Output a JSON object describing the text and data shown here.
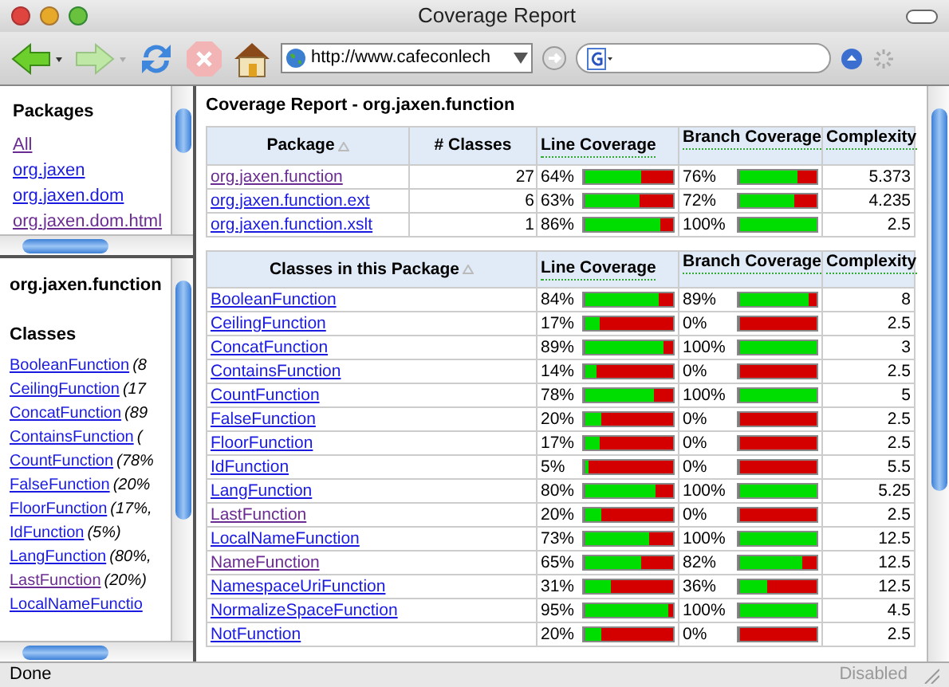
{
  "window": {
    "title": "Coverage Report"
  },
  "toolbar": {
    "url": "http://www.cafeconlech"
  },
  "sidebar": {
    "packages": {
      "heading": "Packages",
      "items": [
        {
          "label": "All",
          "visited": true
        },
        {
          "label": "org.jaxen",
          "visited": false
        },
        {
          "label": "org.jaxen.dom",
          "visited": false
        },
        {
          "label": "org.jaxen.dom.html",
          "visited": true
        }
      ]
    },
    "classes": {
      "package_title": "org.jaxen.function",
      "heading": "Classes",
      "items": [
        {
          "label": "BooleanFunction",
          "note": "(8",
          "visited": false
        },
        {
          "label": "CeilingFunction",
          "note": "(17",
          "visited": false
        },
        {
          "label": "ConcatFunction",
          "note": "(89",
          "visited": false
        },
        {
          "label": "ContainsFunction",
          "note": "(",
          "visited": false
        },
        {
          "label": "CountFunction",
          "note": "(78%",
          "visited": false
        },
        {
          "label": "FalseFunction",
          "note": "(20%",
          "visited": false
        },
        {
          "label": "FloorFunction",
          "note": "(17%,",
          "visited": false
        },
        {
          "label": "IdFunction",
          "note": "(5%)",
          "visited": false
        },
        {
          "label": "LangFunction",
          "note": "(80%,",
          "visited": false
        },
        {
          "label": "LastFunction",
          "note": "(20%)",
          "visited": true
        },
        {
          "label": "LocalNameFunctio",
          "visited": false
        }
      ]
    }
  },
  "report": {
    "title": "Coverage Report - org.jaxen.function",
    "package_table": {
      "columns": [
        "Package",
        "# Classes",
        "Line Coverage",
        "Branch Coverage",
        "Complexity"
      ],
      "rows": [
        {
          "name": "org.jaxen.function",
          "visited": true,
          "classes": "27",
          "line": {
            "reading": "64%",
            "level": 0.64
          },
          "branch": {
            "reading": "76%",
            "level": 0.76
          },
          "complexity": "5.373"
        },
        {
          "name": "org.jaxen.function.ext",
          "visited": false,
          "classes": "6",
          "line": {
            "reading": "63%",
            "level": 0.63
          },
          "branch": {
            "reading": "72%",
            "level": 0.72
          },
          "complexity": "4.235"
        },
        {
          "name": "org.jaxen.function.xslt",
          "visited": false,
          "classes": "1",
          "line": {
            "reading": "86%",
            "level": 0.86
          },
          "branch": {
            "reading": "100%",
            "level": 1
          },
          "complexity": "2.5"
        }
      ]
    },
    "class_table": {
      "columns": [
        "Classes in this Package",
        "Line Coverage",
        "Branch Coverage",
        "Complexity"
      ],
      "rows": [
        {
          "name": "BooleanFunction",
          "visited": false,
          "line": {
            "reading": "84%",
            "level": 0.84
          },
          "branch": {
            "reading": "89%",
            "level": 0.89
          },
          "complexity": "8"
        },
        {
          "name": "CeilingFunction",
          "visited": false,
          "line": {
            "reading": "17%",
            "level": 0.17
          },
          "branch": {
            "reading": "0%",
            "level": 0
          },
          "complexity": "2.5"
        },
        {
          "name": "ConcatFunction",
          "visited": false,
          "line": {
            "reading": "89%",
            "level": 0.89
          },
          "branch": {
            "reading": "100%",
            "level": 1
          },
          "complexity": "3"
        },
        {
          "name": "ContainsFunction",
          "visited": false,
          "line": {
            "reading": "14%",
            "level": 0.14
          },
          "branch": {
            "reading": "0%",
            "level": 0
          },
          "complexity": "2.5"
        },
        {
          "name": "CountFunction",
          "visited": false,
          "line": {
            "reading": "78%",
            "level": 0.78
          },
          "branch": {
            "reading": "100%",
            "level": 1
          },
          "complexity": "5"
        },
        {
          "name": "FalseFunction",
          "visited": false,
          "line": {
            "reading": "20%",
            "level": 0.2
          },
          "branch": {
            "reading": "0%",
            "level": 0
          },
          "complexity": "2.5"
        },
        {
          "name": "FloorFunction",
          "visited": false,
          "line": {
            "reading": "17%",
            "level": 0.17
          },
          "branch": {
            "reading": "0%",
            "level": 0
          },
          "complexity": "2.5"
        },
        {
          "name": "IdFunction",
          "visited": false,
          "line": {
            "reading": "5%",
            "level": 0.05
          },
          "branch": {
            "reading": "0%",
            "level": 0
          },
          "complexity": "5.5"
        },
        {
          "name": "LangFunction",
          "visited": false,
          "line": {
            "reading": "80%",
            "level": 0.8
          },
          "branch": {
            "reading": "100%",
            "level": 1
          },
          "complexity": "5.25"
        },
        {
          "name": "LastFunction",
          "visited": true,
          "line": {
            "reading": "20%",
            "level": 0.2
          },
          "branch": {
            "reading": "0%",
            "level": 0
          },
          "complexity": "2.5"
        },
        {
          "name": "LocalNameFunction",
          "visited": false,
          "line": {
            "reading": "73%",
            "level": 0.73
          },
          "branch": {
            "reading": "100%",
            "level": 1
          },
          "complexity": "12.5"
        },
        {
          "name": "NameFunction",
          "visited": true,
          "line": {
            "reading": "65%",
            "level": 0.65
          },
          "branch": {
            "reading": "82%",
            "level": 0.82
          },
          "complexity": "12.5"
        },
        {
          "name": "NamespaceUriFunction",
          "visited": false,
          "line": {
            "reading": "31%",
            "level": 0.31
          },
          "branch": {
            "reading": "36%",
            "level": 0.36
          },
          "complexity": "12.5"
        },
        {
          "name": "NormalizeSpaceFunction",
          "visited": false,
          "line": {
            "reading": "95%",
            "level": 0.95
          },
          "branch": {
            "reading": "100%",
            "level": 1
          },
          "complexity": "4.5"
        },
        {
          "name": "NotFunction",
          "visited": false,
          "line": {
            "reading": "20%",
            "level": 0.2
          },
          "branch": {
            "reading": "0%",
            "level": 0
          },
          "complexity": "2.5"
        }
      ]
    }
  },
  "status_bar": {
    "text": "Done",
    "right": "Disabled"
  }
}
